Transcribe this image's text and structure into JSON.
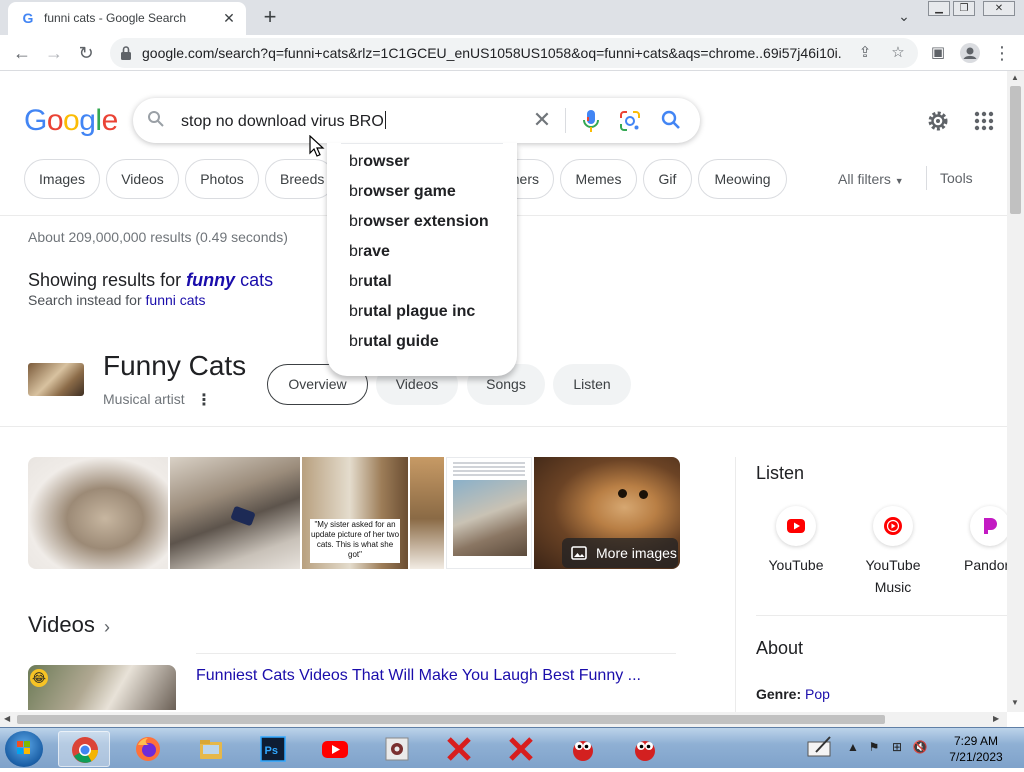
{
  "browser": {
    "tab_title": "funni cats - Google Search",
    "url": "google.com/search?q=funni+cats&rlz=1C1GCEU_enUS1058US1058&oq=funni+cats&aqs=chrome..69i57j46i10i...",
    "window_buttons": [
      "minimize",
      "restore",
      "close"
    ]
  },
  "search": {
    "query": "stop no download virus BRO",
    "logo": "Google",
    "filters": [
      "Images",
      "Videos",
      "Photos",
      "Breeds",
      "...ners",
      "Memes",
      "Gif",
      "Meowing"
    ],
    "all_filters": "All filters",
    "tools": "Tools"
  },
  "autocomplete": {
    "typed": "br",
    "items": [
      {
        "prefix": "br",
        "rest": "owser"
      },
      {
        "prefix": "br",
        "rest": "owser game"
      },
      {
        "prefix": "br",
        "rest": "owser extension"
      },
      {
        "prefix": "br",
        "rest": "ave"
      },
      {
        "prefix": "br",
        "rest": "utal"
      },
      {
        "prefix": "br",
        "rest": "utal plague inc"
      },
      {
        "prefix": "br",
        "rest": "utal guide"
      }
    ]
  },
  "results": {
    "stats": "About 209,000,000 results (0.49 seconds)",
    "showing_prefix": "Showing results for ",
    "showing_bold": "funny",
    "showing_suffix": " cats",
    "instead_prefix": "Search instead for ",
    "instead_link": "funni cats"
  },
  "knowledge_panel": {
    "title": "Funny Cats",
    "subtitle": "Musical artist",
    "tabs": [
      "Overview",
      "Videos",
      "Songs",
      "Listen"
    ],
    "active_tab": "Overview",
    "image_caption": "\"My sister asked for an update picture of her two cats. This is what she got\"",
    "more_images": "More images",
    "listen_title": "Listen",
    "services": [
      "YouTube",
      "YouTube Music",
      "Pandor"
    ],
    "about_title": "About",
    "genre_label": "Genre:",
    "genre_value": "Pop"
  },
  "videos": {
    "title": "Videos",
    "first_title": "Funniest Cats Videos That Will Make You Laugh Best Funny ..."
  },
  "taskbar": {
    "time": "7:29 AM",
    "date": "7/21/2023",
    "apps": [
      "chrome",
      "firefox",
      "file-explorer",
      "photoshop",
      "youtube",
      "app",
      "x-app-1",
      "x-app-2",
      "bug-app-1",
      "bug-app-2"
    ]
  },
  "colors": {
    "link": "#1a0dab",
    "google_blue": "#4285f4",
    "google_red": "#ea4335",
    "google_yellow": "#fbbc05",
    "google_green": "#34a853"
  }
}
